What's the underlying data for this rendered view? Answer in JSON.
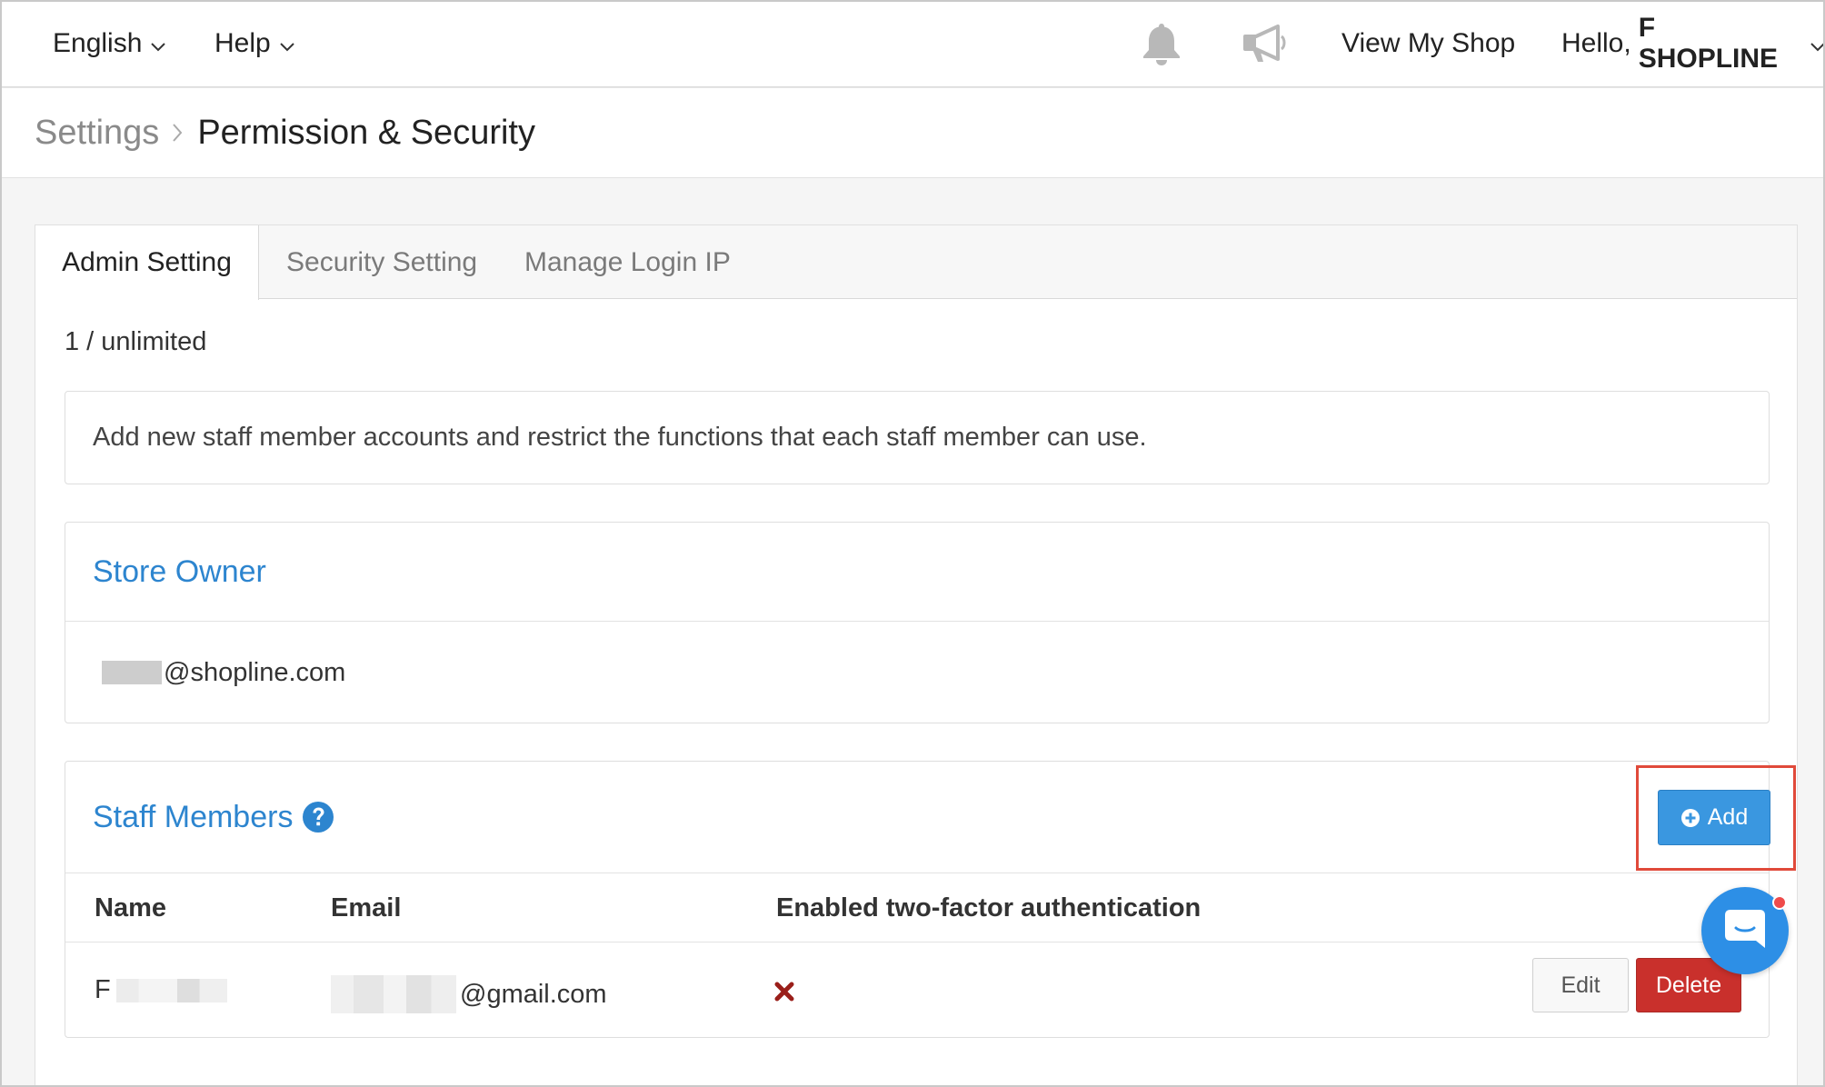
{
  "topnav": {
    "language": "English",
    "help": "Help",
    "view_shop": "View My Shop",
    "greeting": "Hello,",
    "user_name": "F SHOPLINE"
  },
  "breadcrumb": {
    "parent": "Settings",
    "current": "Permission & Security"
  },
  "tabs": [
    {
      "label": "Admin Setting",
      "active": true
    },
    {
      "label": "Security Setting",
      "active": false
    },
    {
      "label": "Manage Login IP",
      "active": false
    }
  ],
  "counter": "1 / unlimited",
  "info_text": "Add new staff member accounts and restrict the functions that each staff member can use.",
  "store_owner": {
    "title": "Store Owner",
    "email_suffix": "@shopline.com"
  },
  "staff": {
    "title": "Staff Members",
    "add_label": "Add",
    "columns": [
      "Name",
      "Email",
      "Enabled two-factor authentication"
    ],
    "rows": [
      {
        "name_prefix": "F",
        "email_suffix": "@gmail.com",
        "two_factor": false
      }
    ],
    "edit_label": "Edit",
    "delete_label": "Delete"
  },
  "colors": {
    "link_blue": "#2d85cf",
    "primary": "#3a97e0",
    "danger": "#c9302c",
    "highlight": "#e04a3a"
  },
  "icons": [
    "bell-icon",
    "megaphone-icon",
    "chevron-down-icon",
    "chevron-right-icon",
    "question-circle-icon",
    "plus-circle-icon",
    "x-mark-icon",
    "chat-icon"
  ]
}
